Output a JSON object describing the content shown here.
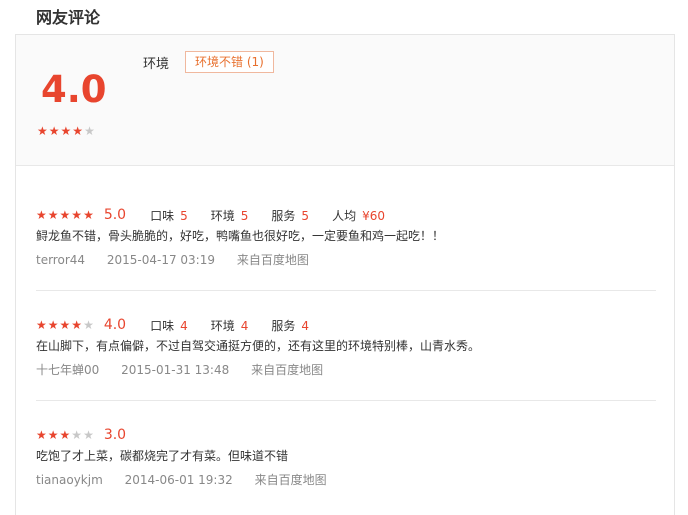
{
  "section_title": "网友评论",
  "summary": {
    "score": "4.0",
    "stars": [
      1,
      1,
      1,
      1,
      0
    ],
    "env_label": "环境",
    "tag": "环境不错 (1)"
  },
  "reviews": [
    {
      "stars": [
        1,
        1,
        1,
        1,
        1
      ],
      "score": "5.0",
      "subs": [
        {
          "label": "口味",
          "value": "5"
        },
        {
          "label": "环境",
          "value": "5"
        },
        {
          "label": "服务",
          "value": "5"
        },
        {
          "label": "人均",
          "value": "¥60"
        }
      ],
      "text": "鲟龙鱼不错，骨头脆脆的，好吃，鸭嘴鱼也很好吃，一定要鱼和鸡一起吃！！",
      "user": "terror44",
      "date": "2015-04-17 03:19",
      "source": "来自百度地图"
    },
    {
      "stars": [
        1,
        1,
        1,
        1,
        0
      ],
      "score": "4.0",
      "subs": [
        {
          "label": "口味",
          "value": "4"
        },
        {
          "label": "环境",
          "value": "4"
        },
        {
          "label": "服务",
          "value": "4"
        }
      ],
      "text": "在山脚下，有点偏僻，不过自驾交通挺方便的，还有这里的环境特别棒，山青水秀。",
      "user": "十七年蝉00",
      "date": "2015-01-31 13:48",
      "source": "来自百度地图"
    },
    {
      "stars": [
        1,
        1,
        1,
        0,
        0
      ],
      "score": "3.0",
      "subs": [],
      "text": "吃饱了才上菜，碳都烧完了才有菜。但味道不错",
      "user": "tianaoykjm",
      "date": "2014-06-01 19:32",
      "source": "来自百度地图"
    }
  ],
  "colors": {
    "accent": "#e8452e",
    "tag": "#e8702e",
    "muted": "#888888"
  },
  "icon_names": {
    "star_on": "star-filled-icon",
    "star_off": "star-empty-icon"
  }
}
